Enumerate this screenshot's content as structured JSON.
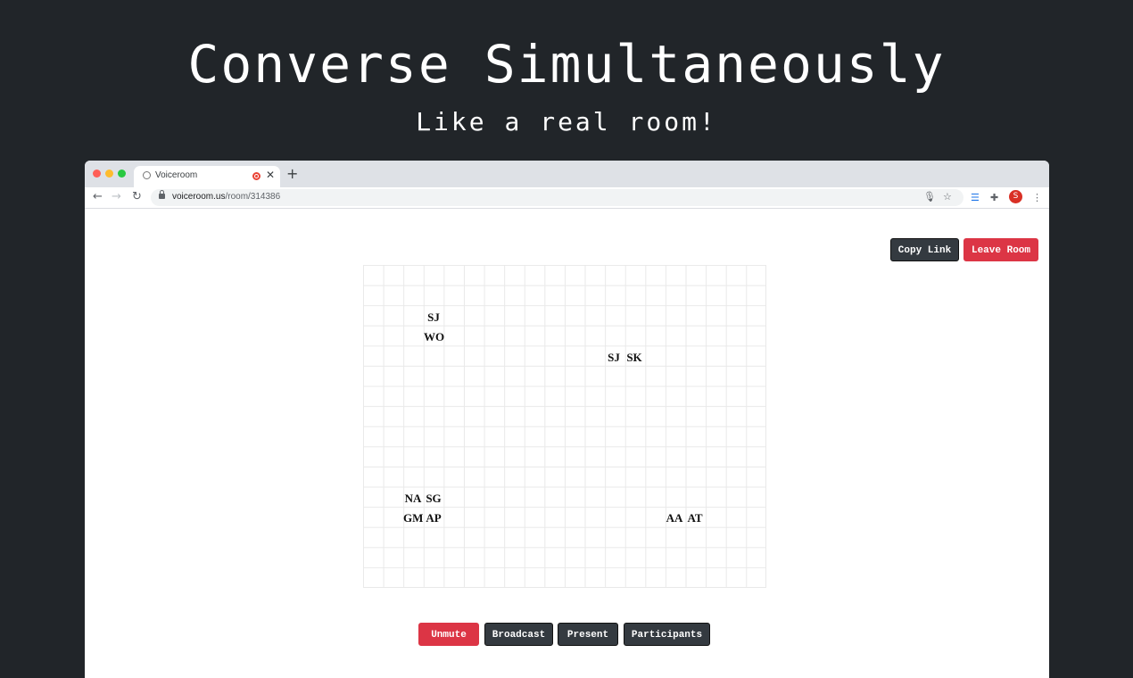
{
  "hero": {
    "title": "Converse Simultaneously",
    "subtitle": "Like a real room!"
  },
  "browser": {
    "tab_title": "Voiceroom",
    "tab_close_icon": "close-icon",
    "new_tab": "+",
    "url_host": "voiceroom.us",
    "url_path": "/room/314386",
    "profile_initial": "S"
  },
  "room": {
    "copy_link_label": "Copy Link",
    "leave_room_label": "Leave Room",
    "participants": [
      "SJ",
      "WO",
      "SJ",
      "SK",
      "NA",
      "SG",
      "GM",
      "AP",
      "AA",
      "AT"
    ]
  },
  "controls": {
    "unmute_label": "Unmute",
    "broadcast_label": "Broadcast",
    "present_label": "Present",
    "participants_label": "Participants"
  },
  "colors": {
    "background": "#212529",
    "dark_button": "#343a40",
    "accent_red": "#dc3545"
  }
}
